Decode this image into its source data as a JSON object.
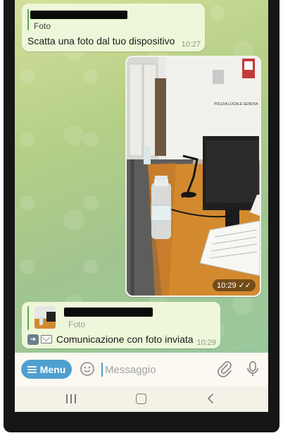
{
  "messages": [
    {
      "reply_type": "Foto",
      "text": "Scatta una foto dal tuo dispositivo",
      "time": "10:27"
    },
    {
      "type": "photo",
      "time": "10:29",
      "status": "read",
      "photo_signage": "POLIZIA LOCALE GENOVA"
    },
    {
      "reply_type": "Foto",
      "text": "Comunicazione con foto inviata",
      "time": "10:29",
      "emojis": [
        "arrow-right-icon",
        "envelope-icon"
      ]
    }
  ],
  "input_bar": {
    "menu_label": "Menu",
    "placeholder": "Messaggio"
  },
  "colors": {
    "accent": "#4f9fd0",
    "bubble": "#eef7d9",
    "reply_bar": "#5aaa5a"
  }
}
